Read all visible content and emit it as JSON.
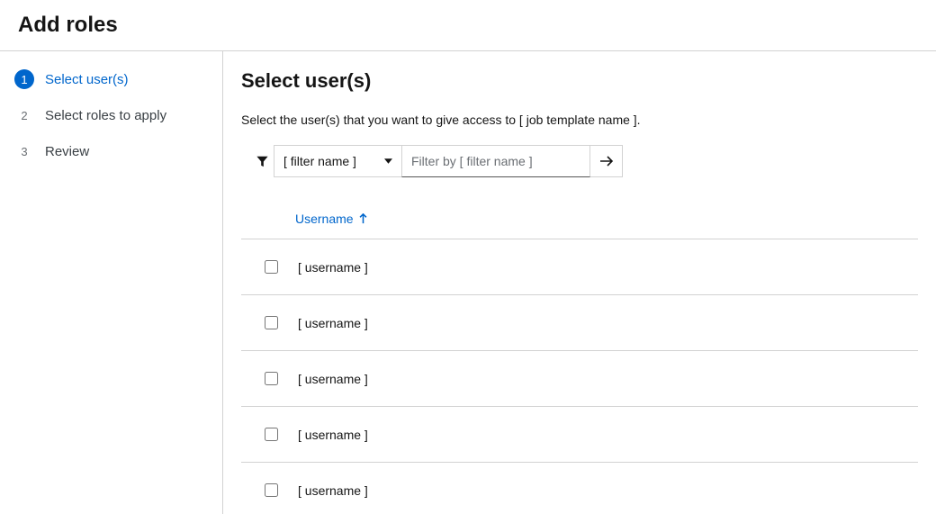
{
  "page_title": "Add roles",
  "wizard_steps": [
    {
      "num": "1",
      "label": "Select user(s)"
    },
    {
      "num": "2",
      "label": "Select roles to apply"
    },
    {
      "num": "3",
      "label": "Review"
    }
  ],
  "main": {
    "title": "Select user(s)",
    "subtitle": "Select the user(s) that you want to give access to [ job template name ]."
  },
  "toolbar": {
    "filter_select_value": "[ filter name ]",
    "filter_input_placeholder": "Filter by [ filter name ]"
  },
  "table": {
    "column_username": "Username",
    "rows": [
      {
        "username": "[ username ]"
      },
      {
        "username": "[ username ]"
      },
      {
        "username": "[ username ]"
      },
      {
        "username": "[ username ]"
      },
      {
        "username": "[ username ]"
      }
    ]
  }
}
